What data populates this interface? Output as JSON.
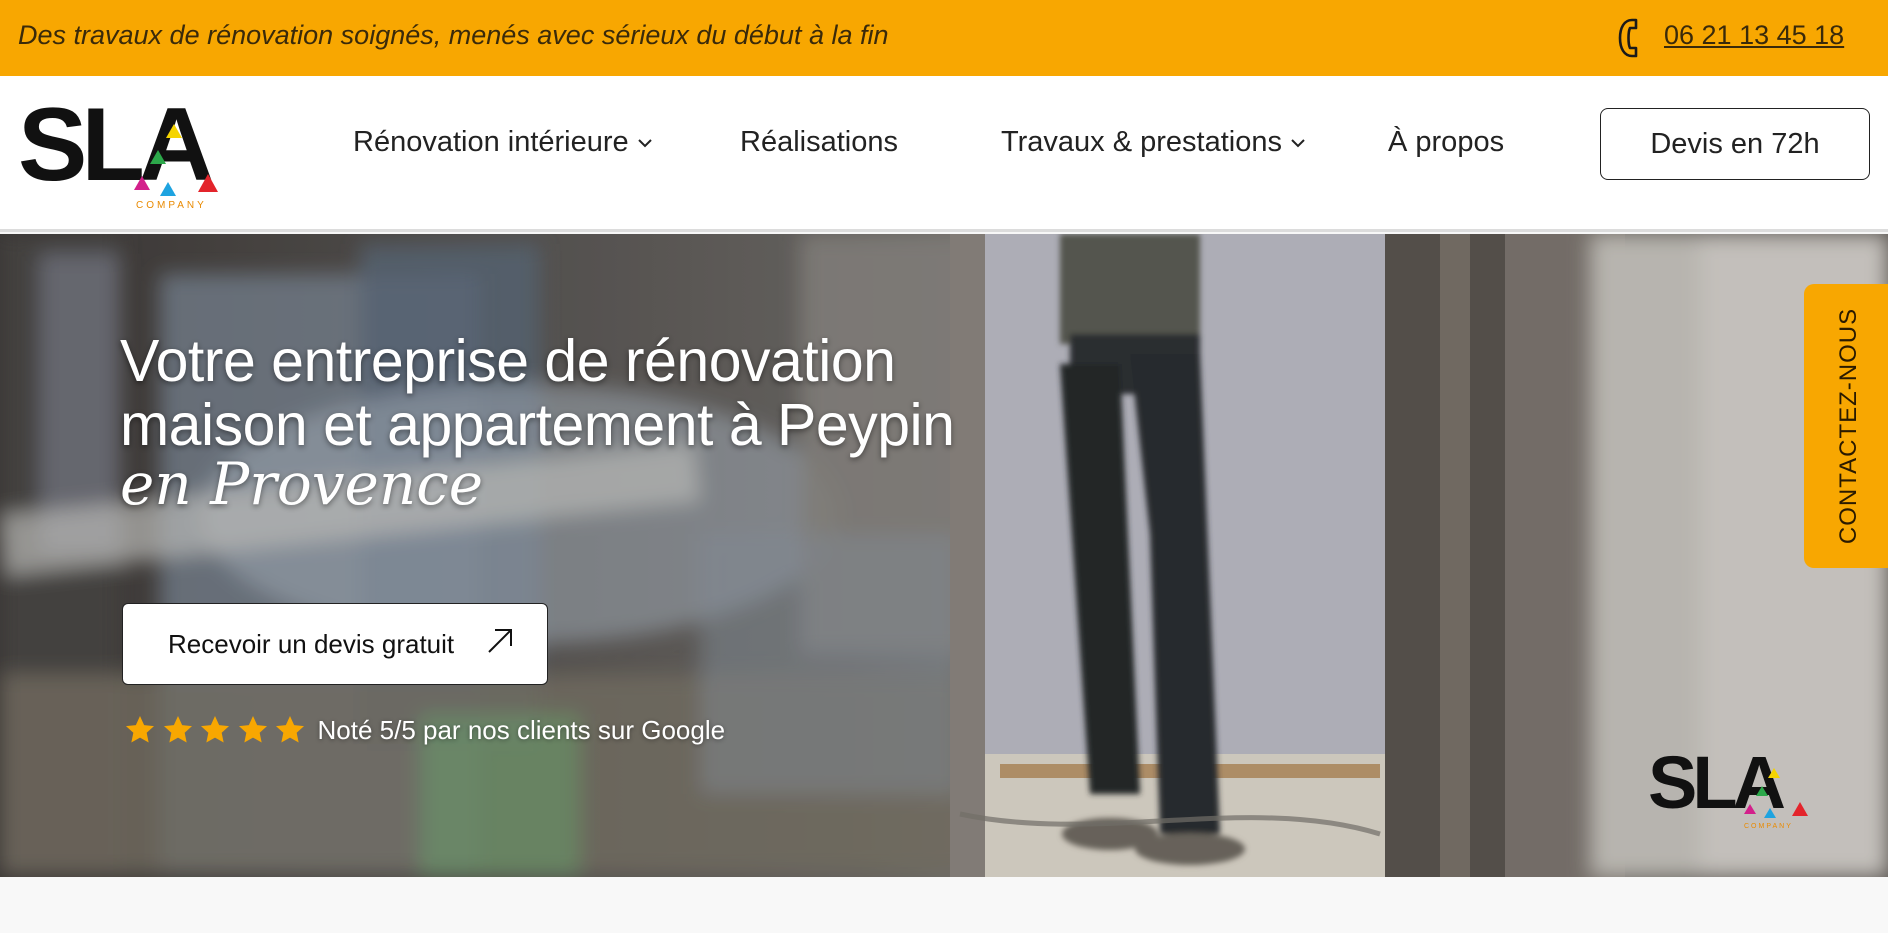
{
  "topbar": {
    "tagline": "Des travaux de rénovation soignés, menés avec sérieux du début à la fin",
    "phone_icon": "phone-icon",
    "phone": "06 21 13 45 18",
    "color": "#f8a701"
  },
  "header": {
    "logo_text": "SLA",
    "logo_sub": "COMPANY",
    "nav": [
      {
        "label": "Rénovation intérieure",
        "has_dropdown": true
      },
      {
        "label": "Réalisations",
        "has_dropdown": false
      },
      {
        "label": "Travaux & prestations",
        "has_dropdown": true
      },
      {
        "label": "À propos",
        "has_dropdown": false
      }
    ],
    "cta_label": "Devis en 72h"
  },
  "hero": {
    "title_line1": "Votre entreprise de rénovation",
    "title_line2": "maison et appartement à Peypin",
    "script": "en Provence",
    "cta_label": "Recevoir un devis gratuit",
    "cta_icon": "arrow-up-right-icon",
    "stars": 5,
    "rating_text": "Noté 5/5 par nos clients sur Google",
    "star_color": "#f8a701",
    "contact_tab": "CONTACTEZ-NOUS",
    "watermark_logo": "SLA",
    "watermark_sub": "COMPANY"
  }
}
